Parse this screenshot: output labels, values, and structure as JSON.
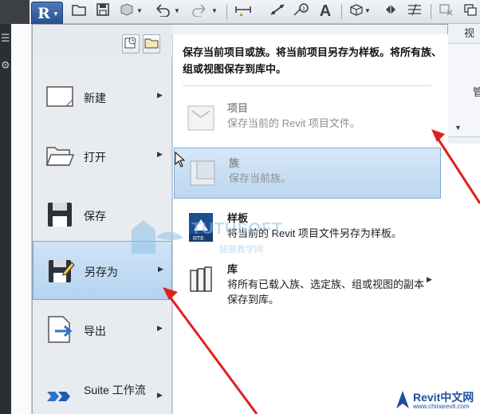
{
  "submenu": {
    "header": "保存当前项目或族。将当前项目另存为样板。将所有族、组或视图保存到库中。",
    "items": [
      {
        "title": "项目",
        "desc": "保存当前的 Revit 项目文件。",
        "state": "disabled"
      },
      {
        "title": "族",
        "desc": "保存当前族。",
        "state": "highlighted"
      },
      {
        "title": "样板",
        "desc": "将当前的 Revit 项目文件另存为样板。",
        "state": "normal"
      },
      {
        "title": "库",
        "desc": "将所有已载入族、选定族、组或视图的副本保存到库。",
        "state": "normal"
      }
    ]
  },
  "menu": {
    "commands": [
      {
        "label": "新建",
        "has_submenu": true
      },
      {
        "label": "打开",
        "has_submenu": true
      },
      {
        "label": "保存",
        "has_submenu": false
      },
      {
        "label": "另存为",
        "has_submenu": true,
        "active": true
      },
      {
        "label": "导出",
        "has_submenu": true
      },
      {
        "label": "Suite 工作流",
        "has_submenu": true
      }
    ]
  },
  "ribbon": {
    "tab_fragment": "视",
    "label_fragment": "管"
  },
  "watermark": {
    "text": "TUTUSOFT",
    "subtext": "腿腿教学网"
  },
  "logo": {
    "title": "Revit中文网",
    "url": "www.chinarevit.com"
  },
  "colors": {
    "app_button": "#2f5fa6",
    "highlight": "#bcd6ef",
    "annotation": "#e0201b"
  }
}
